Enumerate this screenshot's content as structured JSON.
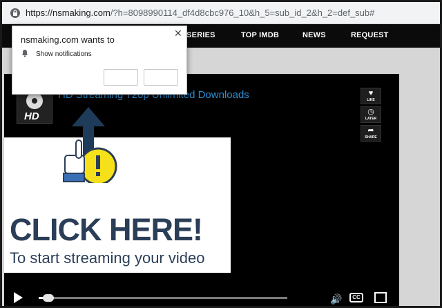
{
  "browser": {
    "url_host": "https://nsmaking.com",
    "url_rest": "/?h=8098990114_df4d8cbc976_10&h_5=sub_id_2&h_2=def_sub#"
  },
  "site_nav": {
    "items": [
      "- SERIES",
      "TOP IMDB",
      "NEWS",
      "REQUEST"
    ]
  },
  "video": {
    "logo_text": "HD",
    "title": "HD Streaming  720p  Unlimited Downloads",
    "side_buttons": [
      {
        "glyph": "heart-icon",
        "label": "LIKE"
      },
      {
        "glyph": "clock-icon",
        "label": "LATER"
      },
      {
        "glyph": "share-icon",
        "label": "SHARE"
      }
    ],
    "progress_fraction": 0.03,
    "cc_label": "CC"
  },
  "ad": {
    "headline": "CLICK HERE!",
    "subline": "To start streaming your video",
    "colors": {
      "text": "#2b3e57",
      "warning": "#f5e01a",
      "arrow": "#1f3b5a"
    }
  },
  "notification": {
    "title": "nsmaking.com wants to",
    "permission": "Show notifications",
    "close_icon": "close-icon",
    "allow_label": "",
    "block_label": ""
  }
}
